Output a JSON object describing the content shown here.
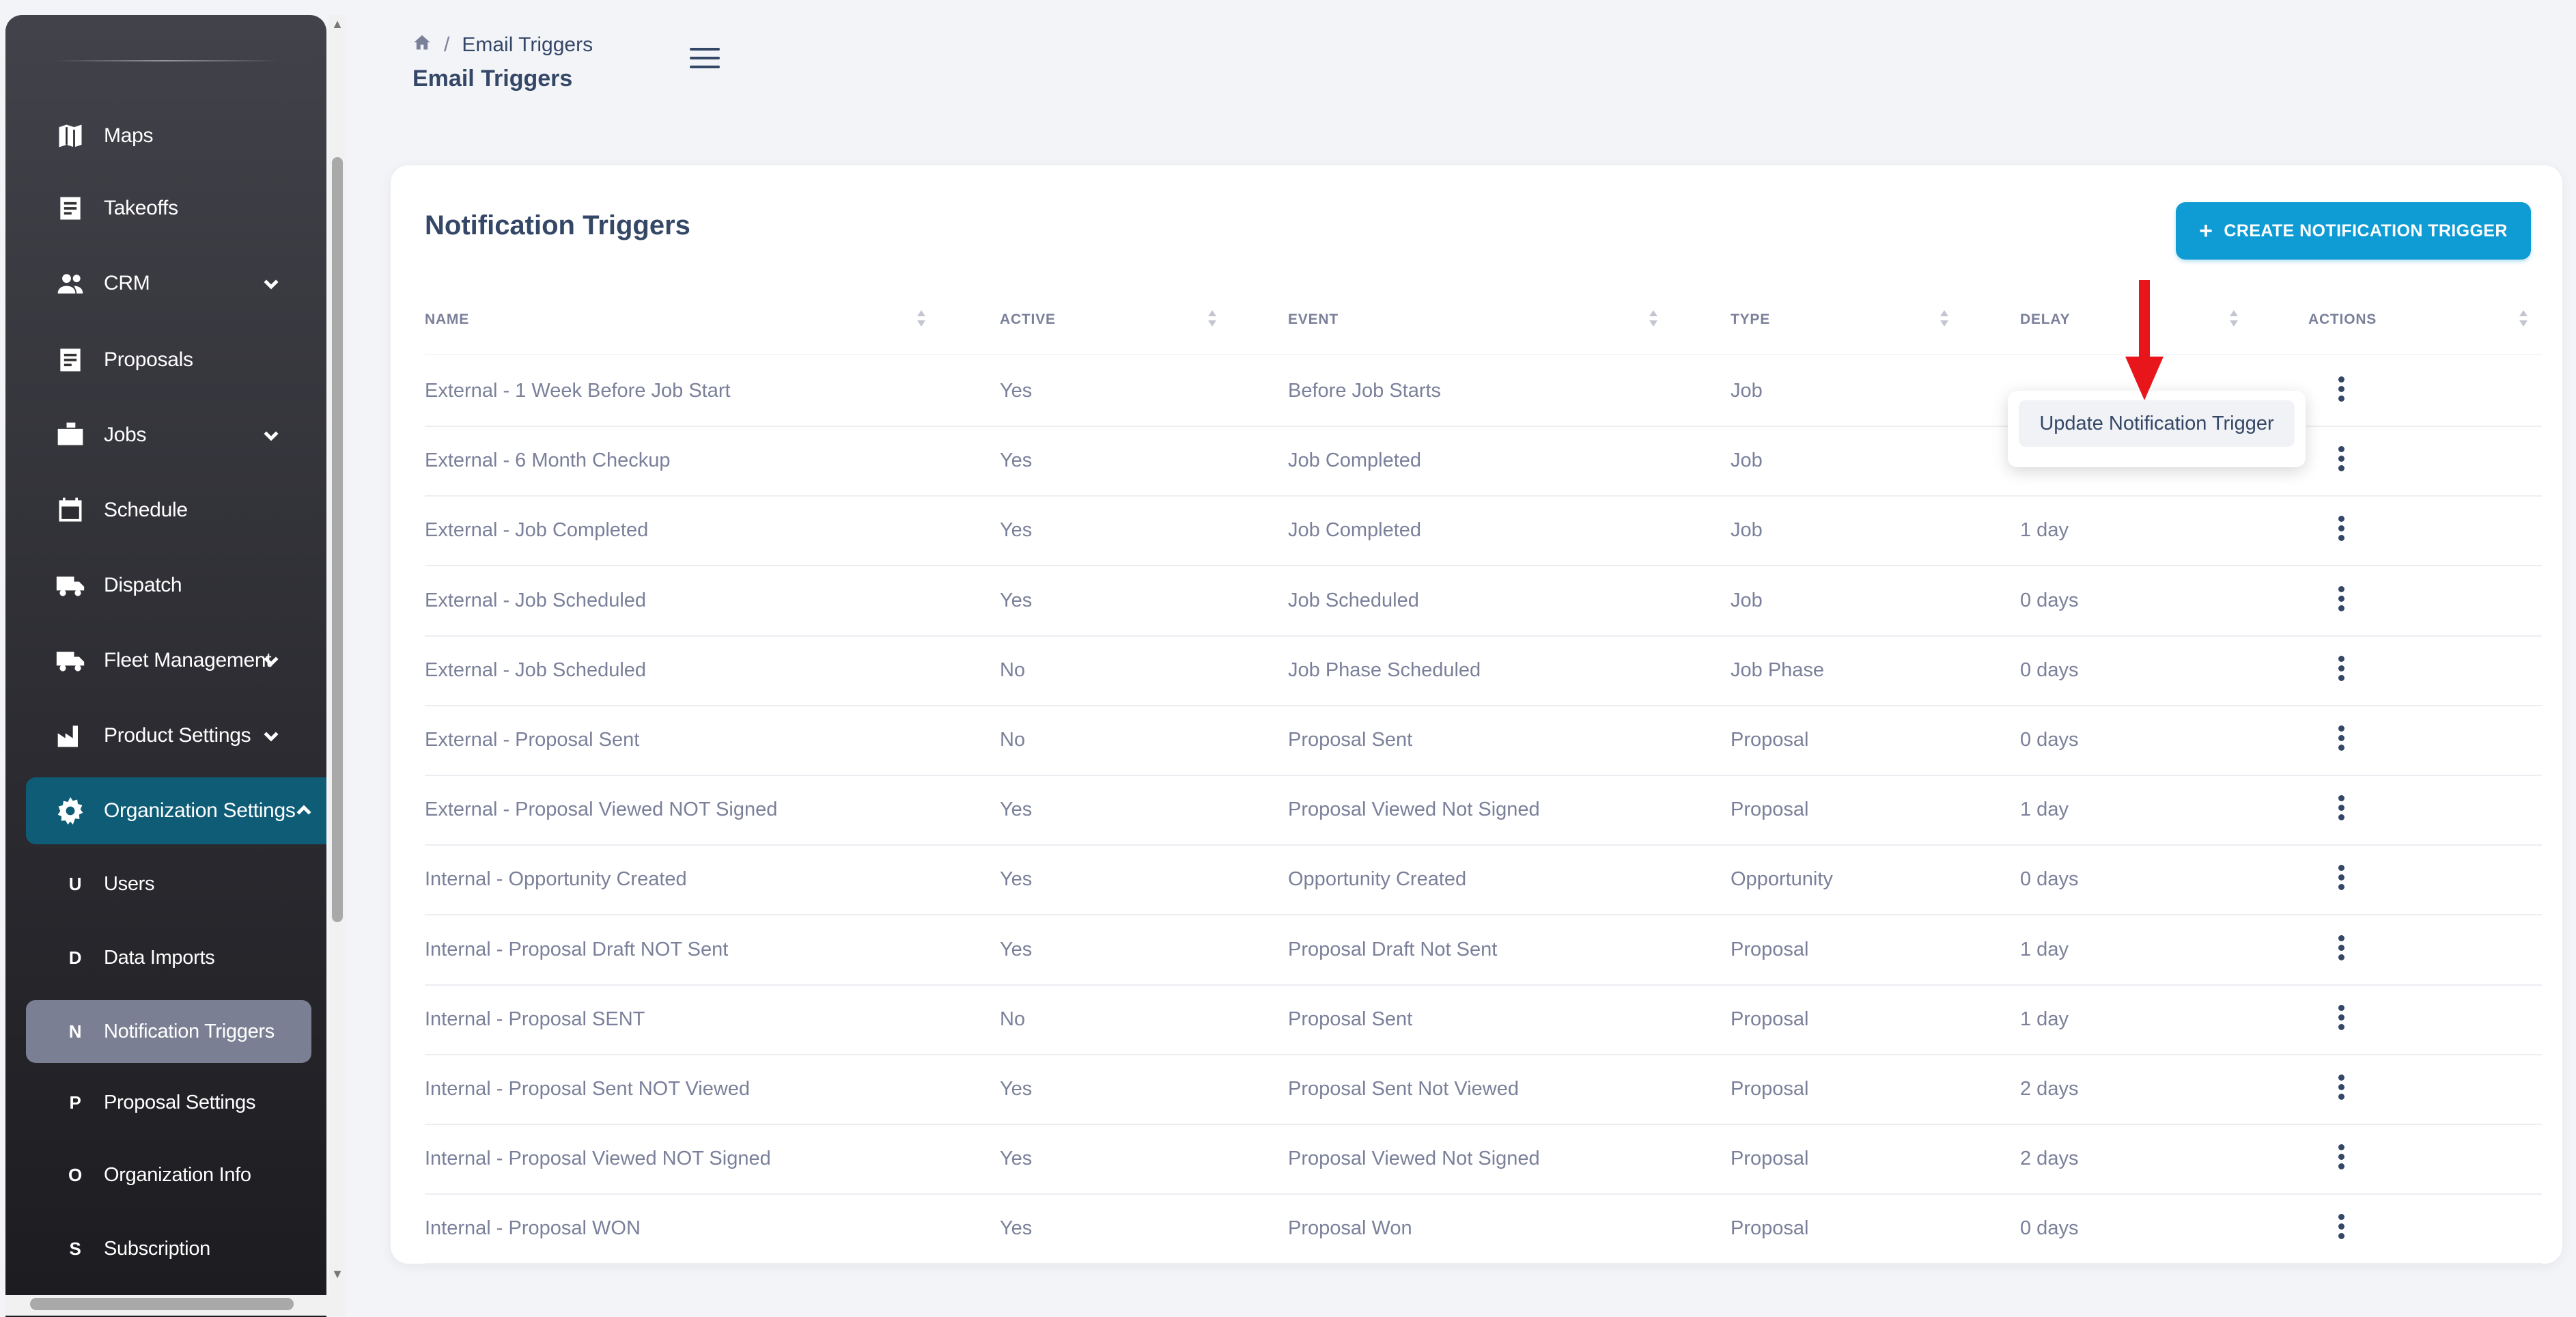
{
  "breadcrumb": {
    "current": "Email Triggers"
  },
  "page_title": "Email Triggers",
  "sidebar": {
    "items": [
      {
        "label": "Maps",
        "icon": "map-icon"
      },
      {
        "label": "Takeoffs",
        "icon": "document-icon"
      },
      {
        "label": "CRM",
        "icon": "people-icon",
        "expandable": true
      },
      {
        "label": "Proposals",
        "icon": "document-icon"
      },
      {
        "label": "Jobs",
        "icon": "briefcase-icon",
        "expandable": true
      },
      {
        "label": "Schedule",
        "icon": "calendar-icon"
      },
      {
        "label": "Dispatch",
        "icon": "truck-icon"
      },
      {
        "label": "Fleet Management",
        "icon": "truck-icon",
        "expandable": true
      },
      {
        "label": "Product Settings",
        "icon": "factory-icon",
        "expandable": true
      },
      {
        "label": "Organization Settings",
        "icon": "gear-icon",
        "expandable": true,
        "expanded": true,
        "active": true
      }
    ],
    "sub_items": [
      {
        "letter": "U",
        "label": "Users"
      },
      {
        "letter": "D",
        "label": "Data Imports"
      },
      {
        "letter": "N",
        "label": "Notification Triggers",
        "selected": true
      },
      {
        "letter": "P",
        "label": "Proposal Settings"
      },
      {
        "letter": "O",
        "label": "Organization Info"
      },
      {
        "letter": "S",
        "label": "Subscription"
      }
    ]
  },
  "card": {
    "title": "Notification Triggers",
    "create_button": "CREATE NOTIFICATION TRIGGER"
  },
  "table": {
    "columns": [
      "NAME",
      "ACTIVE",
      "EVENT",
      "TYPE",
      "DELAY",
      "ACTIONS"
    ],
    "rows": [
      {
        "name": "External - 1 Week Before Job Start",
        "active": "Yes",
        "event": "Before Job Starts",
        "type": "Job",
        "delay": ""
      },
      {
        "name": "External - 6 Month Checkup",
        "active": "Yes",
        "event": "Job Completed",
        "type": "Job",
        "delay": ""
      },
      {
        "name": "External - Job Completed",
        "active": "Yes",
        "event": "Job Completed",
        "type": "Job",
        "delay": "1 day"
      },
      {
        "name": "External - Job Scheduled",
        "active": "Yes",
        "event": "Job Scheduled",
        "type": "Job",
        "delay": "0 days"
      },
      {
        "name": "External - Job Scheduled",
        "active": "No",
        "event": "Job Phase Scheduled",
        "type": "Job Phase",
        "delay": "0 days"
      },
      {
        "name": "External - Proposal Sent",
        "active": "No",
        "event": "Proposal Sent",
        "type": "Proposal",
        "delay": "0 days"
      },
      {
        "name": "External - Proposal Viewed NOT Signed",
        "active": "Yes",
        "event": "Proposal Viewed Not Signed",
        "type": "Proposal",
        "delay": "1 day"
      },
      {
        "name": "Internal - Opportunity Created",
        "active": "Yes",
        "event": "Opportunity Created",
        "type": "Opportunity",
        "delay": "0 days"
      },
      {
        "name": "Internal - Proposal Draft NOT Sent",
        "active": "Yes",
        "event": "Proposal Draft Not Sent",
        "type": "Proposal",
        "delay": "1 day"
      },
      {
        "name": "Internal - Proposal SENT",
        "active": "No",
        "event": "Proposal Sent",
        "type": "Proposal",
        "delay": "1 day"
      },
      {
        "name": "Internal - Proposal Sent NOT Viewed",
        "active": "Yes",
        "event": "Proposal Sent Not Viewed",
        "type": "Proposal",
        "delay": "2 days"
      },
      {
        "name": "Internal - Proposal Viewed NOT Signed",
        "active": "Yes",
        "event": "Proposal Viewed Not Signed",
        "type": "Proposal",
        "delay": "2 days"
      },
      {
        "name": "Internal - Proposal WON",
        "active": "Yes",
        "event": "Proposal Won",
        "type": "Proposal",
        "delay": "0 days"
      }
    ]
  },
  "popup": {
    "item": "Update Notification Trigger"
  },
  "colors": {
    "accent": "#0f9bd3",
    "active_nav": "#0f5c77",
    "selected_sub": "#7b7f93",
    "annotation_arrow": "#e8161b"
  }
}
